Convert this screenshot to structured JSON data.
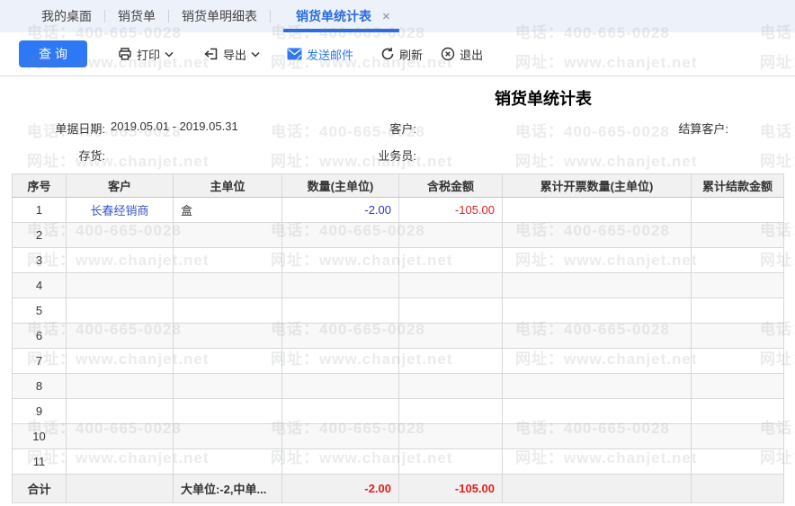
{
  "tabs": [
    {
      "label": "我的桌面",
      "active": false
    },
    {
      "label": "销货单",
      "active": false
    },
    {
      "label": "销货单明细表",
      "active": false
    },
    {
      "label": "销货单统计表",
      "active": true
    }
  ],
  "tab_close_glyph": "×",
  "toolbar": {
    "query_label": "查询",
    "print_label": "打印",
    "export_label": "导出",
    "email_label": "发送邮件",
    "refresh_label": "刷新",
    "exit_label": "退出"
  },
  "report": {
    "title": "销货单统计表",
    "filters": {
      "date_label": "单据日期:",
      "date_value": "2019.05.01 - 2019.05.31",
      "customer_label": "客户:",
      "customer_value": "",
      "settle_customer_label": "结算客户:",
      "settle_customer_value": "",
      "inventory_label": "存货:",
      "inventory_value": "",
      "salesman_label": "业务员:",
      "salesman_value": ""
    }
  },
  "table": {
    "headers": [
      "序号",
      "客户",
      "主单位",
      "数量(主单位)",
      "含税金额",
      "累计开票数量(主单位)",
      "累计结款金额"
    ],
    "rows": [
      {
        "cells": [
          "1",
          "长春经销商",
          "盒",
          "-2.00",
          "-105.00",
          "",
          ""
        ],
        "classes": [
          "",
          "link",
          "",
          "num-blue",
          "num-red",
          "",
          ""
        ]
      },
      {
        "cells": [
          "2",
          "",
          "",
          "",
          "",
          "",
          ""
        ]
      },
      {
        "cells": [
          "3",
          "",
          "",
          "",
          "",
          "",
          ""
        ]
      },
      {
        "cells": [
          "4",
          "",
          "",
          "",
          "",
          "",
          ""
        ]
      },
      {
        "cells": [
          "5",
          "",
          "",
          "",
          "",
          "",
          ""
        ]
      },
      {
        "cells": [
          "6",
          "",
          "",
          "",
          "",
          "",
          ""
        ]
      },
      {
        "cells": [
          "7",
          "",
          "",
          "",
          "",
          "",
          ""
        ]
      },
      {
        "cells": [
          "8",
          "",
          "",
          "",
          "",
          "",
          ""
        ]
      },
      {
        "cells": [
          "9",
          "",
          "",
          "",
          "",
          "",
          ""
        ]
      },
      {
        "cells": [
          "10",
          "",
          "",
          "",
          "",
          "",
          ""
        ]
      },
      {
        "cells": [
          "11",
          "",
          "",
          "",
          "",
          "",
          ""
        ]
      }
    ],
    "total_row": {
      "cells": [
        "合计",
        "",
        "大单位:-2,中单...",
        "-2.00",
        "-105.00",
        "",
        ""
      ],
      "classes": [
        "bold",
        "",
        "bold",
        "num-red bold",
        "num-red bold",
        "",
        ""
      ]
    }
  },
  "watermark": {
    "line1": "电话：400-665-0028",
    "line2": "网址：www.chanjet.net"
  },
  "colors": {
    "accent": "#2d78f4",
    "active_tab": "#2a6ce2",
    "link_blue": "#3c55c8",
    "num_blue": "#2334d0",
    "num_red": "#e02020"
  }
}
